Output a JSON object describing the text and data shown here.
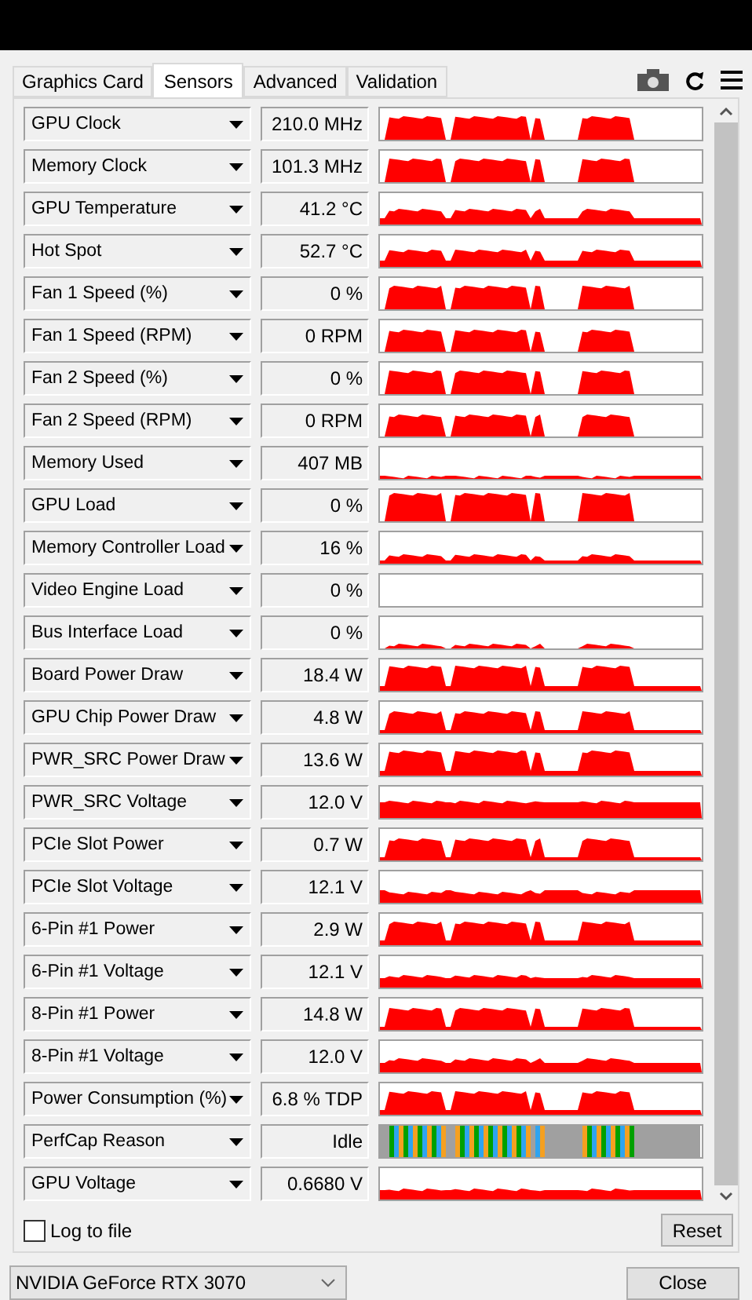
{
  "tabs": [
    {
      "label": "Graphics Card",
      "selected": false
    },
    {
      "label": "Sensors",
      "selected": true
    },
    {
      "label": "Advanced",
      "selected": false
    },
    {
      "label": "Validation",
      "selected": false
    }
  ],
  "sensors": [
    {
      "name": "GPU Clock",
      "value": "210.0 MHz",
      "kind": "line"
    },
    {
      "name": "Memory Clock",
      "value": "101.3 MHz",
      "kind": "line"
    },
    {
      "name": "GPU Temperature",
      "value": "41.2 °C",
      "kind": "line"
    },
    {
      "name": "Hot Spot",
      "value": "52.7 °C",
      "kind": "line"
    },
    {
      "name": "Fan 1 Speed (%)",
      "value": "0 %",
      "kind": "line"
    },
    {
      "name": "Fan 1 Speed (RPM)",
      "value": "0 RPM",
      "kind": "line"
    },
    {
      "name": "Fan 2 Speed (%)",
      "value": "0 %",
      "kind": "line"
    },
    {
      "name": "Fan 2 Speed (RPM)",
      "value": "0 RPM",
      "kind": "line"
    },
    {
      "name": "Memory Used",
      "value": "407 MB",
      "kind": "line"
    },
    {
      "name": "GPU Load",
      "value": "0 %",
      "kind": "line"
    },
    {
      "name": "Memory Controller Load",
      "value": "16 %",
      "kind": "line"
    },
    {
      "name": "Video Engine Load",
      "value": "0 %",
      "kind": "line"
    },
    {
      "name": "Bus Interface Load",
      "value": "0 %",
      "kind": "line"
    },
    {
      "name": "Board Power Draw",
      "value": "18.4 W",
      "kind": "line"
    },
    {
      "name": "GPU Chip Power Draw",
      "value": "4.8 W",
      "kind": "line"
    },
    {
      "name": "PWR_SRC Power Draw",
      "value": "13.6 W",
      "kind": "line"
    },
    {
      "name": "PWR_SRC Voltage",
      "value": "12.0 V",
      "kind": "line"
    },
    {
      "name": "PCIe Slot Power",
      "value": "0.7 W",
      "kind": "line"
    },
    {
      "name": "PCIe Slot Voltage",
      "value": "12.1 V",
      "kind": "line"
    },
    {
      "name": "6-Pin #1 Power",
      "value": "2.9 W",
      "kind": "line"
    },
    {
      "name": "6-Pin #1 Voltage",
      "value": "12.1 V",
      "kind": "line"
    },
    {
      "name": "8-Pin #1 Power",
      "value": "14.8 W",
      "kind": "line"
    },
    {
      "name": "8-Pin #1 Voltage",
      "value": "12.0 V",
      "kind": "line"
    },
    {
      "name": "Power Consumption (%)",
      "value": "6.8 % TDP",
      "kind": "line"
    },
    {
      "name": "PerfCap Reason",
      "value": "Idle",
      "kind": "perfcap"
    },
    {
      "name": "GPU Voltage",
      "value": "0.6680 V",
      "kind": "line"
    }
  ],
  "log_to_file": {
    "label": "Log to file",
    "checked": false
  },
  "reset_button": "Reset",
  "device": "NVIDIA GeForce RTX 3070",
  "close_button": "Close"
}
